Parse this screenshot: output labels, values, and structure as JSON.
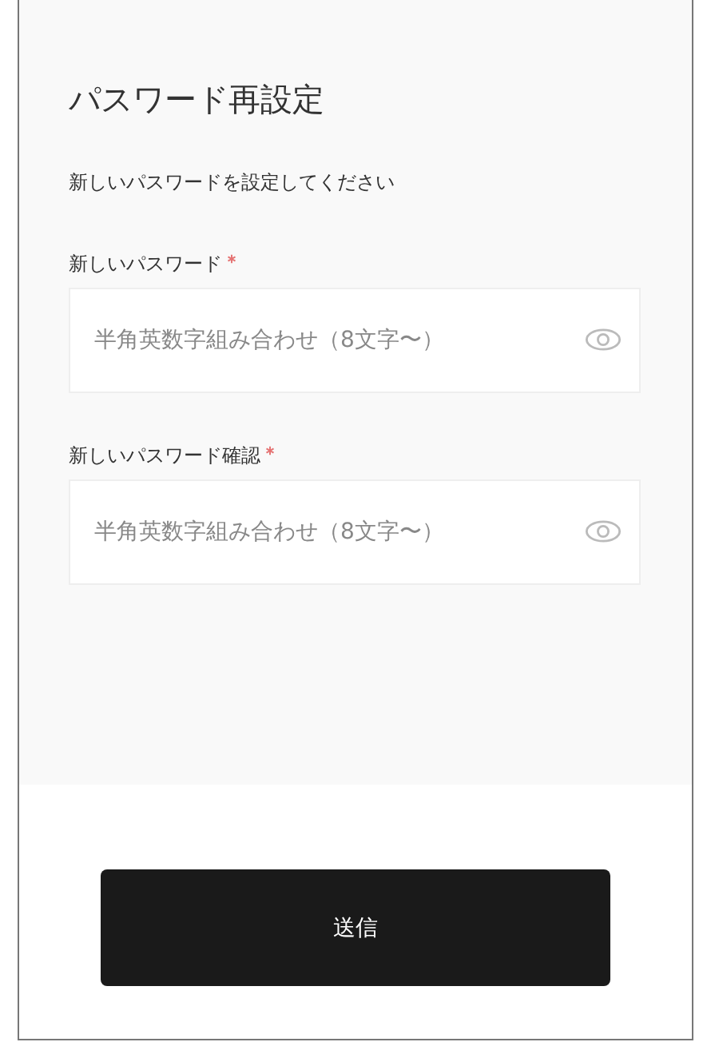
{
  "title": "パスワード再設定",
  "description": "新しいパスワードを設定してください",
  "fields": [
    {
      "label": "新しいパスワード",
      "required": true,
      "placeholder": "半角英数字組み合わせ（8文字〜）"
    },
    {
      "label": "新しいパスワード確認",
      "required": true,
      "placeholder": "半角英数字組み合わせ（8文字〜）"
    }
  ],
  "submit_button": "送信"
}
